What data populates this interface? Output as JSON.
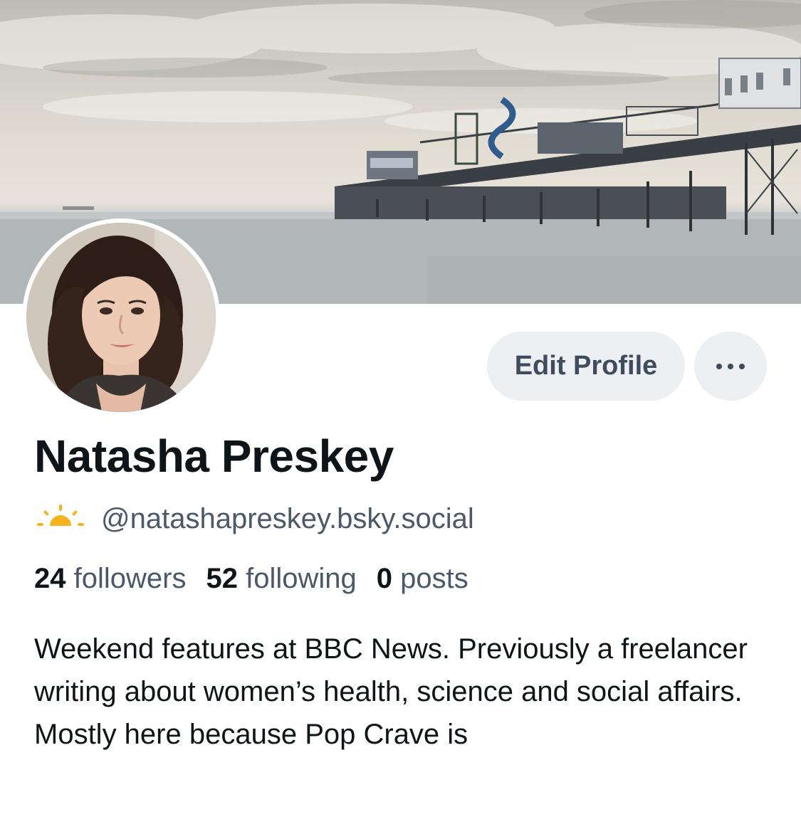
{
  "profile": {
    "display_name": "Natasha Preskey",
    "handle": "@natashapreskey.bsky.social",
    "handle_emoji_icon": "sunrise-icon",
    "bio": "Weekend features at BBC News. Previously a freelancer writing about women’s health, science and social affairs. Mostly here because Pop Crave is"
  },
  "actions": {
    "edit_label": "Edit Profile",
    "more_icon": "ellipsis-icon"
  },
  "stats": {
    "followers_count": "24",
    "followers_label": "followers",
    "following_count": "52",
    "following_label": "following",
    "posts_count": "0",
    "posts_label": "posts"
  },
  "colors": {
    "primary_text": "#0f1419",
    "secondary_text": "#4b586a",
    "button_bg": "#edf0f3",
    "button_text": "#3f4c5e",
    "emoji_sun": "#f5b31e"
  }
}
